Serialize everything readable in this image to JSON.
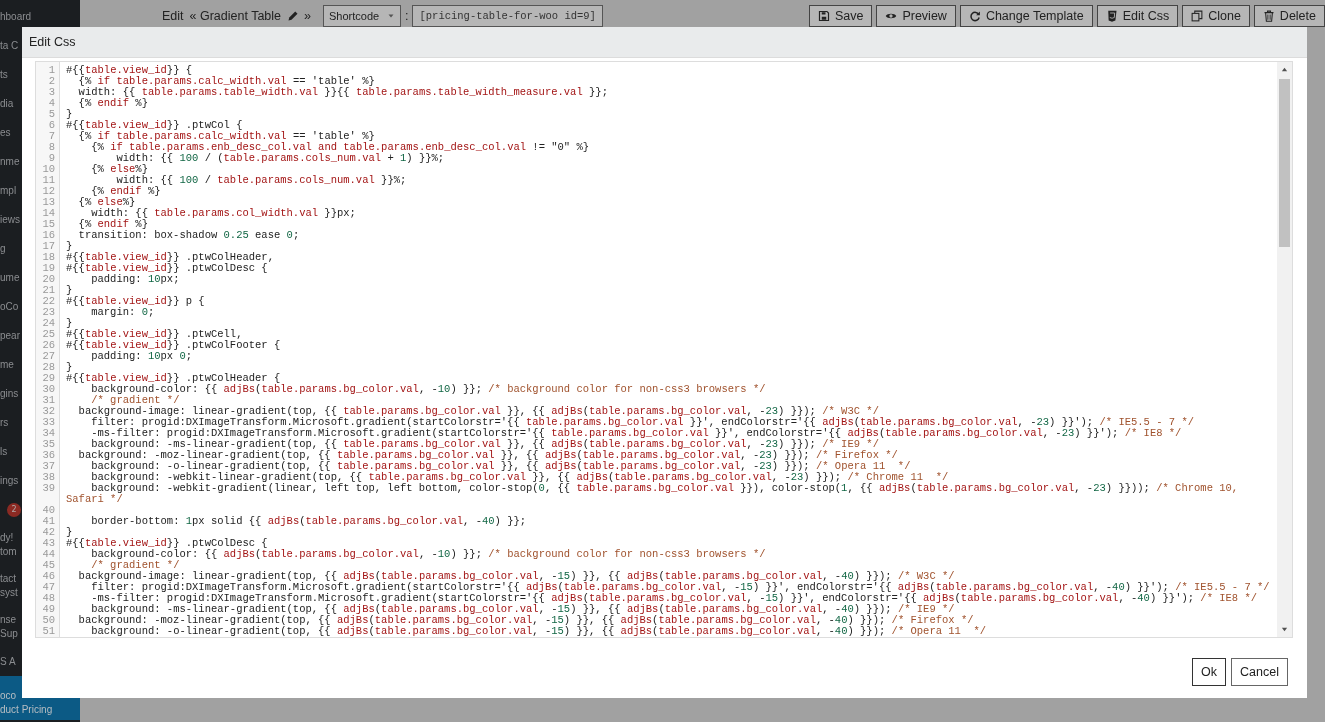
{
  "sidebar": {
    "items": [
      {
        "kind": "text",
        "lines": [
          "hboard"
        ],
        "selected": false
      },
      {
        "kind": "text",
        "lines": [
          "ta C"
        ],
        "selected": false
      },
      {
        "kind": "text",
        "lines": [
          "ts"
        ],
        "selected": false
      },
      {
        "kind": "text",
        "lines": [
          "dia"
        ],
        "selected": false
      },
      {
        "kind": "text",
        "lines": [
          "es"
        ],
        "selected": false
      },
      {
        "kind": "text",
        "lines": [
          "nme"
        ],
        "selected": false
      },
      {
        "kind": "text",
        "lines": [
          "mpl"
        ],
        "selected": false
      },
      {
        "kind": "text",
        "lines": [
          "iews"
        ],
        "selected": false
      },
      {
        "kind": "text",
        "lines": [
          "g"
        ],
        "selected": false
      },
      {
        "kind": "text",
        "lines": [
          "ume"
        ],
        "selected": false
      },
      {
        "kind": "text",
        "lines": [
          "oCo"
        ],
        "selected": false
      },
      {
        "kind": "text",
        "lines": [
          "pear"
        ],
        "selected": false
      },
      {
        "kind": "text",
        "lines": [
          "me"
        ],
        "selected": false
      },
      {
        "kind": "text",
        "lines": [
          "gins"
        ],
        "selected": false
      },
      {
        "kind": "text",
        "lines": [
          "rs"
        ],
        "selected": false
      },
      {
        "kind": "text",
        "lines": [
          "ls"
        ],
        "selected": false
      },
      {
        "kind": "text",
        "lines": [
          "ings"
        ],
        "selected": false
      },
      {
        "kind": "badge",
        "badge": "2",
        "selected": false
      },
      {
        "kind": "text",
        "lines": [
          "dy!",
          "tom"
        ],
        "selected": false
      },
      {
        "kind": "text",
        "lines": [
          "tact",
          "syst"
        ],
        "selected": false
      },
      {
        "kind": "text",
        "lines": [
          "nse",
          "Sup"
        ],
        "selected": false
      },
      {
        "kind": "text",
        "lines": [
          "S A"
        ],
        "selected": false
      },
      {
        "kind": "text",
        "lines": [
          "oco",
          "duct Pricing"
        ],
        "selected": true
      }
    ]
  },
  "toolbar": {
    "edit_label": "Edit",
    "title": "« Gradient Table",
    "after": "»",
    "select": {
      "value": "Shortcode"
    },
    "separator": ":",
    "shortcode": "[pricing-table-for-woo id=9]",
    "buttons": [
      {
        "kind": "save",
        "label": "Save"
      },
      {
        "kind": "preview",
        "label": "Preview"
      },
      {
        "kind": "template",
        "label": "Change Template"
      },
      {
        "kind": "css",
        "label": "Edit Css"
      },
      {
        "kind": "clone",
        "label": "Clone"
      },
      {
        "kind": "delete",
        "label": "Delete"
      }
    ]
  },
  "dialog": {
    "title": "Edit Css",
    "code_lines": [
      {
        "number": "1",
        "text": "#{{table.view_id}} {"
      },
      {
        "number": "2",
        "text": "  {% if table.params.calc_width.val == 'table' %}"
      },
      {
        "number": "3",
        "text": "  width: {{ table.params.table_width.val }}{{ table.params.table_width_measure.val }};"
      },
      {
        "number": "4",
        "text": "  {% endif %}"
      },
      {
        "number": "5",
        "text": "}"
      },
      {
        "number": "6",
        "text": "#{{table.view_id}} .ptwCol {"
      },
      {
        "number": "7",
        "text": "  {% if table.params.calc_width.val == 'table' %}"
      },
      {
        "number": "8",
        "text": "    {% if table.params.enb_desc_col.val and table.params.enb_desc_col.val != \"0\" %}"
      },
      {
        "number": "9",
        "text": "        width: {{ 100 / (table.params.cols_num.val + 1) }}%;"
      },
      {
        "number": "10",
        "text": "    {% else%}"
      },
      {
        "number": "11",
        "text": "        width: {{ 100 / table.params.cols_num.val }}%;"
      },
      {
        "number": "12",
        "text": "    {% endif %}"
      },
      {
        "number": "13",
        "text": "  {% else%}"
      },
      {
        "number": "14",
        "text": "    width: {{ table.params.col_width.val }}px;"
      },
      {
        "number": "15",
        "text": "  {% endif %}"
      },
      {
        "number": "16",
        "text": "  transition: box-shadow 0.25 ease 0;"
      },
      {
        "number": "17",
        "text": "}"
      },
      {
        "number": "18",
        "text": "#{{table.view_id}} .ptwColHeader,"
      },
      {
        "number": "19",
        "text": "#{{table.view_id}} .ptwColDesc {"
      },
      {
        "number": "20",
        "text": "    padding: 10px;"
      },
      {
        "number": "21",
        "text": "}"
      },
      {
        "number": "22",
        "text": "#{{table.view_id}} p {"
      },
      {
        "number": "23",
        "text": "    margin: 0;"
      },
      {
        "number": "24",
        "text": "}"
      },
      {
        "number": "25",
        "text": "#{{table.view_id}} .ptwCell,"
      },
      {
        "number": "26",
        "text": "#{{table.view_id}} .ptwColFooter {"
      },
      {
        "number": "27",
        "text": "    padding: 10px 0;"
      },
      {
        "number": "28",
        "text": "}"
      },
      {
        "number": "29",
        "text": "#{{table.view_id}} .ptwColHeader {"
      },
      {
        "number": "30",
        "text": "    background-color: {{ adjBs(table.params.bg_color.val, -10) }}; /* background color for non-css3 browsers */"
      },
      {
        "number": "31",
        "text": "    /* gradient */"
      },
      {
        "number": "32",
        "text": "  background-image: linear-gradient(top, {{ table.params.bg_color.val }}, {{ adjBs(table.params.bg_color.val, -23) }}); /* W3C */"
      },
      {
        "number": "33",
        "text": "    filter: progid:DXImageTransform.Microsoft.gradient(startColorstr='{{ table.params.bg_color.val }}', endColorstr='{{ adjBs(table.params.bg_color.val, -23) }}'); /* IE5.5 - 7 */"
      },
      {
        "number": "34",
        "text": "    -ms-filter: progid:DXImageTransform.Microsoft.gradient(startColorstr='{{ table.params.bg_color.val }}', endColorstr='{{ adjBs(table.params.bg_color.val, -23) }}'); /* IE8 */"
      },
      {
        "number": "35",
        "text": "    background: -ms-linear-gradient(top, {{ table.params.bg_color.val }}, {{ adjBs(table.params.bg_color.val, -23) }}); /* IE9 */"
      },
      {
        "number": "36",
        "text": "  background: -moz-linear-gradient(top, {{ table.params.bg_color.val }}, {{ adjBs(table.params.bg_color.val, -23) }}); /* Firefox */"
      },
      {
        "number": "37",
        "text": "    background: -o-linear-gradient(top, {{ table.params.bg_color.val }}, {{ adjBs(table.params.bg_color.val, -23) }}); /* Opera 11  */"
      },
      {
        "number": "38",
        "text": "    background: -webkit-linear-gradient(top, {{ table.params.bg_color.val }}, {{ adjBs(table.params.bg_color.val, -23) }}); /* Chrome 11  */"
      },
      {
        "number": "39",
        "text": "    background: -webkit-gradient(linear, left top, left bottom, color-stop(0, {{ table.params.bg_color.val }}), color-stop(1, {{ adjBs(table.params.bg_color.val, -23) }})); /* Chrome 10, Safari */"
      },
      {
        "number": "40"
      },
      {
        "number": "41",
        "text": "    border-bottom: 1px solid {{ adjBs(table.params.bg_color.val, -40) }};"
      },
      {
        "number": "42",
        "text": "}"
      },
      {
        "number": "43",
        "text": "#{{table.view_id}} .ptwColDesc {"
      },
      {
        "number": "44",
        "text": "    background-color: {{ adjBs(table.params.bg_color.val, -10) }}; /* background color for non-css3 browsers */"
      },
      {
        "number": "45",
        "text": "    /* gradient */"
      },
      {
        "number": "46",
        "text": "  background-image: linear-gradient(top, {{ adjBs(table.params.bg_color.val, -15) }}, {{ adjBs(table.params.bg_color.val, -40) }}); /* W3C */"
      },
      {
        "number": "47",
        "text": "    filter: progid:DXImageTransform.Microsoft.gradient(startColorstr='{{ adjBs(table.params.bg_color.val, -15) }}', endColorstr='{{ adjBs(table.params.bg_color.val, -40) }}'); /* IE5.5 - 7 */"
      },
      {
        "number": "48",
        "text": "    -ms-filter: progid:DXImageTransform.Microsoft.gradient(startColorstr='{{ adjBs(table.params.bg_color.val, -15) }}', endColorstr='{{ adjBs(table.params.bg_color.val, -40) }}'); /* IE8 */"
      },
      {
        "number": "49",
        "text": "    background: -ms-linear-gradient(top, {{ adjBs(table.params.bg_color.val, -15) }}, {{ adjBs(table.params.bg_color.val, -40) }}); /* IE9 */"
      },
      {
        "number": "50",
        "text": "  background: -moz-linear-gradient(top, {{ adjBs(table.params.bg_color.val, -15) }}, {{ adjBs(table.params.bg_color.val, -40) }}); /* Firefox */"
      },
      {
        "number": "51",
        "text": "    background: -o-linear-gradient(top, {{ adjBs(table.params.bg_color.val, -15) }}, {{ adjBs(table.params.bg_color.val, -40) }}); /* Opera 11  */"
      }
    ],
    "buttons": [
      {
        "kind": "primary",
        "label": "Ok"
      },
      {
        "kind": "secondary",
        "label": "Cancel"
      }
    ]
  }
}
